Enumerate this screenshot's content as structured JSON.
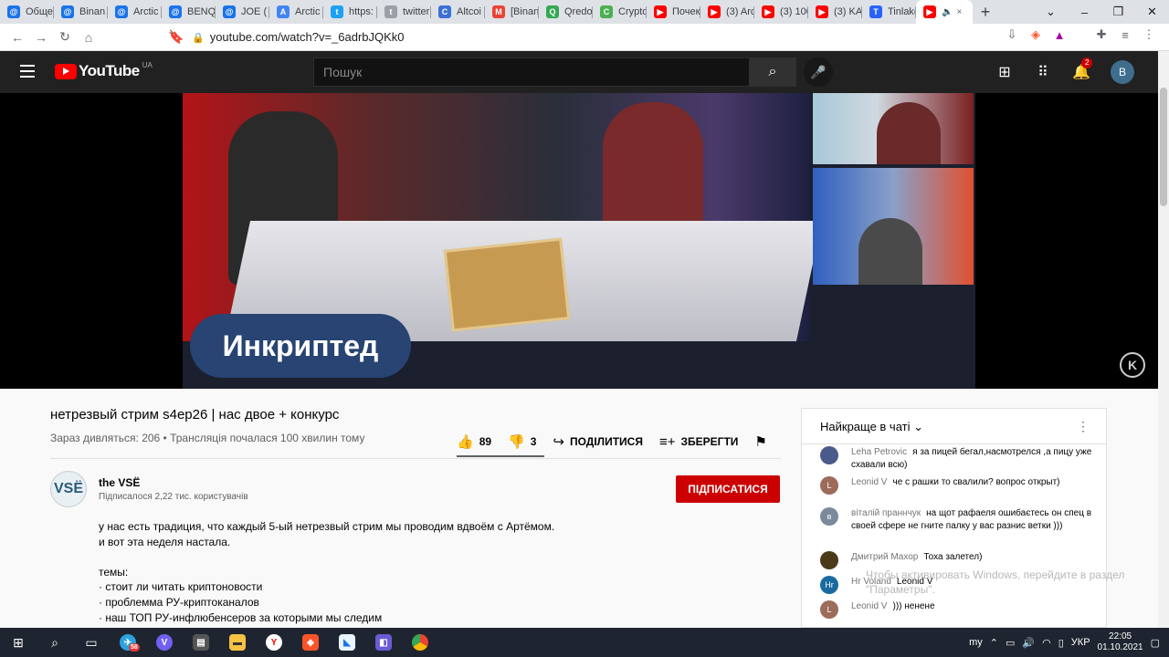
{
  "browser": {
    "tabs": [
      {
        "label": "Обще",
        "icon": "at-icon",
        "color": "#1a73e8"
      },
      {
        "label": "Binan",
        "icon": "at-icon",
        "color": "#1a73e8"
      },
      {
        "label": "Arctic",
        "icon": "at-icon",
        "color": "#1a73e8"
      },
      {
        "label": "BENQ",
        "icon": "at-icon",
        "color": "#1a73e8"
      },
      {
        "label": "JOE (",
        "icon": "at-icon",
        "color": "#1a73e8"
      },
      {
        "label": "Arctic",
        "icon": "arctic-icon",
        "color": "#4285f4"
      },
      {
        "label": "https:",
        "icon": "twitter-icon",
        "color": "#1da1f2"
      },
      {
        "label": "twitter",
        "icon": "twitter-gray-icon",
        "color": "#9aa0a6"
      },
      {
        "label": "Altcoi",
        "icon": "altcoin-icon",
        "color": "#3b6fd4"
      },
      {
        "label": "[Binan",
        "icon": "gmail-icon",
        "color": "#ea4335"
      },
      {
        "label": "Qredo",
        "icon": "qredo-icon",
        "color": "#34a853"
      },
      {
        "label": "Crypto",
        "icon": "crypto-icon",
        "color": "#4caf50"
      },
      {
        "label": "Почек",
        "icon": "youtube-icon",
        "color": "#ff0000"
      },
      {
        "label": "(3) Arc",
        "icon": "youtube-icon",
        "color": "#ff0000"
      },
      {
        "label": "(3) 100",
        "icon": "youtube-icon",
        "color": "#ff0000"
      },
      {
        "label": "(3) KA",
        "icon": "youtube-icon",
        "color": "#ff0000"
      },
      {
        "label": "Tinlake",
        "icon": "tinlake-icon",
        "color": "#2762ff"
      }
    ],
    "active_tab_close": "×",
    "new_tab": "+",
    "url": "youtube.com/watch?v=_6adrbJQKk0"
  },
  "youtube": {
    "logo_text": "YouTube",
    "logo_region": "UA",
    "search_placeholder": "Пошук",
    "notification_count": "2",
    "avatar_letter": "B"
  },
  "video": {
    "overlay_label": "Инкриптед",
    "title": "нетрезвый стрим s4ep26 | нас двое + конкурс",
    "meta": "Зараз дивляться: 206 • Трансляція почалася 100 хвилин тому",
    "likes": "89",
    "dislikes": "3",
    "share": "ПОДІЛИТИСЯ",
    "save": "ЗБЕРЕГТИ"
  },
  "channel": {
    "logo_text": "VSË",
    "name": "the VSË",
    "subscribers": "Підписалося 2,22 тис. користувачів",
    "subscribe": "ПІДПИСАТИСЯ"
  },
  "description": [
    "у нас есть традиция, что каждый 5-ый нетрезвый стрим мы проводим вдвоём с Артёмом.",
    "и вот эта неделя настала.",
    "",
    "темы:",
    "· стоит ли читать криптоновости",
    "· проблемма РУ-криптоканалов",
    "· наш ТОП РУ-инфлюбенсеров за которыми мы следим"
  ],
  "chat": {
    "header": "Найкраще в чаті",
    "messages": [
      {
        "author": "Leha Petrovic",
        "text": "я за пицей бегал,насмотрелся ,а пицу уже схавали всю)",
        "avatar": "",
        "color": "#4a5a8a"
      },
      {
        "author": "Leonid V",
        "text": "че с рашки то свалили? вопрос открыт)",
        "avatar": "L",
        "color": "#9c6b5a"
      },
      {
        "author": "віталій праннчук",
        "text": "на щот рафаеля ошибаєтесь он спец в своей сфере не гните палку у вас разнис ветки )))",
        "avatar": "в",
        "color": "#7a8a9a"
      },
      {
        "author": "Дмитрий Махор",
        "text": "Тоха залетел)",
        "avatar": "",
        "color": "#4a3a1a"
      },
      {
        "author": "Hr Voland",
        "text": "Leonid V",
        "avatar": "Hr",
        "color": "#1a6aa0"
      },
      {
        "author": "Leonid V",
        "text": "))) ненене",
        "avatar": "L",
        "color": "#9c6b5a"
      }
    ],
    "watermark_line1": "Чтобы активировать Windows, перейдите в раздел",
    "watermark_line2": "\"Параметры\"."
  },
  "taskbar": {
    "lang_left": "my",
    "lang": "УКР",
    "time": "22:05",
    "date": "01.10.2021",
    "telegram_badge": "58"
  }
}
